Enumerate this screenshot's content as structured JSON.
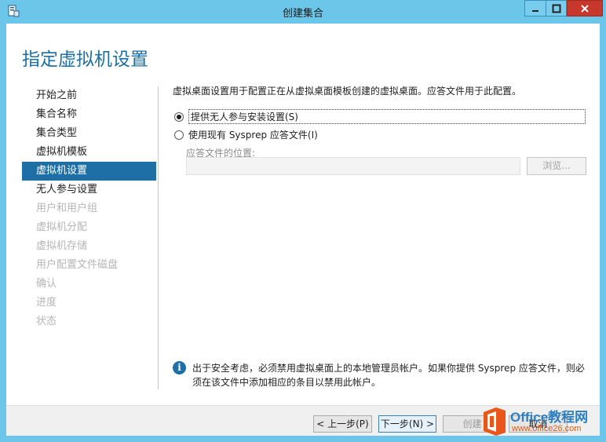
{
  "window": {
    "title": "创建集合",
    "page_title": "指定虚拟机设置"
  },
  "steps": [
    {
      "label": "开始之前",
      "state": "normal"
    },
    {
      "label": "集合名称",
      "state": "normal"
    },
    {
      "label": "集合类型",
      "state": "normal"
    },
    {
      "label": "虚拟机模板",
      "state": "normal"
    },
    {
      "label": "虚拟机设置",
      "state": "active"
    },
    {
      "label": "无人参与设置",
      "state": "normal"
    },
    {
      "label": "用户和用户组",
      "state": "disabled"
    },
    {
      "label": "虚拟机分配",
      "state": "disabled"
    },
    {
      "label": "虚拟机存储",
      "state": "disabled"
    },
    {
      "label": "用户配置文件磁盘",
      "state": "disabled"
    },
    {
      "label": "确认",
      "state": "disabled"
    },
    {
      "label": "进度",
      "state": "disabled"
    },
    {
      "label": "状态",
      "state": "disabled"
    }
  ],
  "main": {
    "description": "虚拟桌面设置用于配置正在从虚拟桌面模板创建的虚拟桌面。应答文件用于此配置。",
    "option_unattended": "提供无人参与安装设置(S)",
    "option_sysprep": "使用现有 Sysprep 应答文件(I)",
    "answer_file_label": "应答文件的位置:",
    "answer_file_value": "",
    "browse_label": "浏览...",
    "info_text": "出于安全考虑，必须禁用虚拟桌面上的本地管理员帐户。如果你提供 Sysprep 应答文件，则必须在该文件中添加相应的条目以禁用此帐户。"
  },
  "footer": {
    "prev_label": "< 上一步(P)",
    "next_label": "下一步(N) >",
    "create_label": "创建",
    "cancel_label": "取消"
  },
  "watermark": {
    "brand": "Office教程网",
    "url": "www.office26.com"
  },
  "colors": {
    "accent": "#1d6fa5",
    "titlebar": "#6cc6ea",
    "close": "#c7372b"
  }
}
